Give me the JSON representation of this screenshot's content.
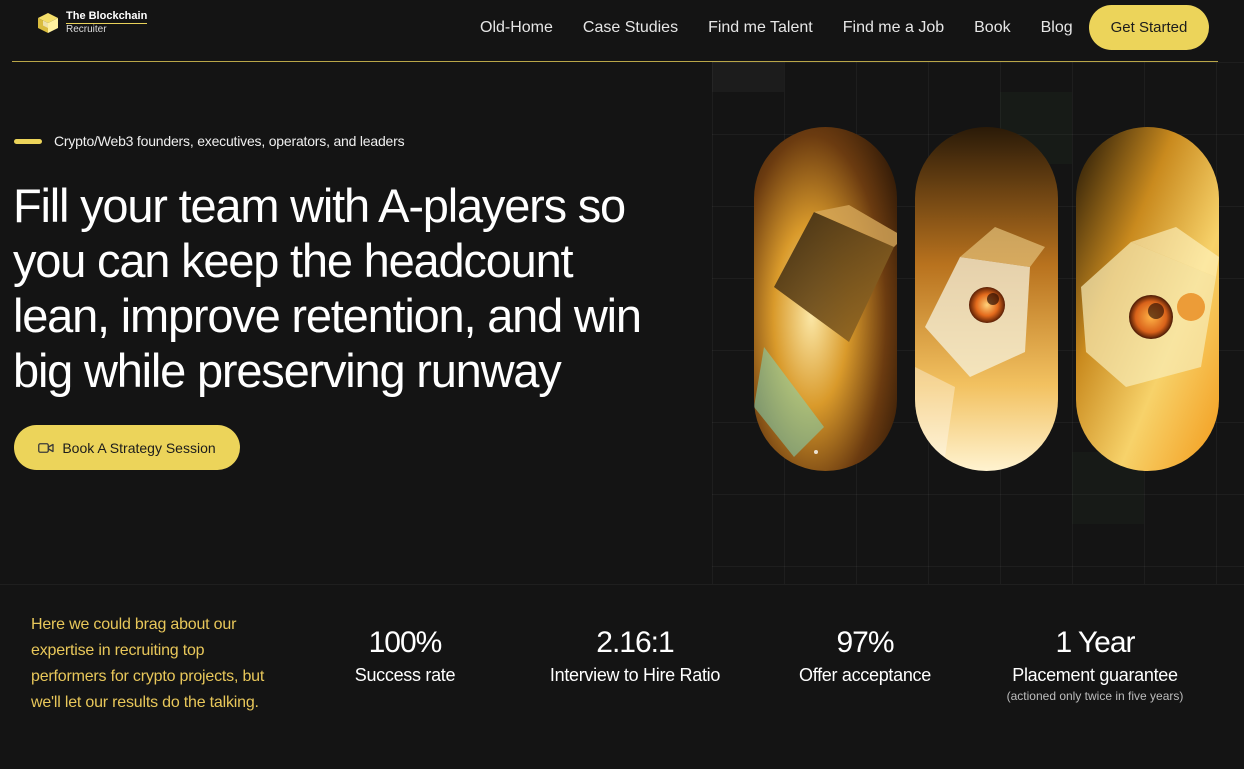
{
  "brand": {
    "name_line1": "The Blockchain",
    "name_line2": "Recruiter"
  },
  "nav": {
    "links": [
      "Old-Home",
      "Case Studies",
      "Find me Talent",
      "Find me a Job",
      "Book",
      "Blog"
    ],
    "cta_label": "Get Started"
  },
  "hero": {
    "eyebrow": "Crypto/Web3 founders, executives, operators, and leaders",
    "headline_lines": [
      "Fill your team with A-players so",
      "you can keep the headcount",
      "lean, improve retention, and win",
      "big while preserving runway"
    ],
    "cta_label": "Book A Strategy Session",
    "cta_icon": "video-camera-icon"
  },
  "stats": {
    "intro": "Here we could brag about our expertise in recruiting top performers for crypto projects, but we'll let our results do the talking.",
    "items": [
      {
        "value": "100%",
        "label": "Success rate",
        "note": ""
      },
      {
        "value": "2.16:1",
        "label": "Interview to Hire Ratio",
        "note": ""
      },
      {
        "value": "97%",
        "label": "Offer acceptance",
        "note": ""
      },
      {
        "value": "1 Year",
        "label": "Placement guarantee",
        "note": "(actioned only twice in five years)"
      }
    ]
  },
  "colors": {
    "accent": "#ecd45a",
    "background": "#141414",
    "brag_text": "#e8c75a"
  }
}
